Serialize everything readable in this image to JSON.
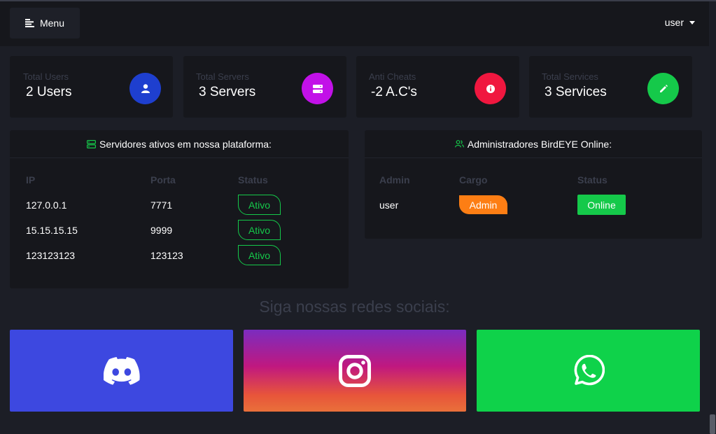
{
  "navbar": {
    "menu_label": "Menu",
    "user_label": "user"
  },
  "stats": [
    {
      "label": "Total Users",
      "value": "2 Users",
      "icon": "user-icon",
      "color": "#1e3fcf"
    },
    {
      "label": "Total Servers",
      "value": "3 Servers",
      "icon": "server-icon",
      "color": "#c211e8"
    },
    {
      "label": "Anti Cheats",
      "value": "-2 A.C's",
      "icon": "info-icon",
      "color": "#f0173f"
    },
    {
      "label": "Total Services",
      "value": "3 Services",
      "icon": "pencil-icon",
      "color": "#15c94a"
    }
  ],
  "servers_panel": {
    "title": "Servidores ativos em nossa plataforma:",
    "columns": [
      "IP",
      "Porta",
      "Status"
    ],
    "rows": [
      {
        "ip": "127.0.0.1",
        "port": "7771",
        "status": "Ativo"
      },
      {
        "ip": "15.15.15.15",
        "port": "9999",
        "status": "Ativo"
      },
      {
        "ip": "123123123",
        "port": "123123",
        "status": "Ativo"
      }
    ]
  },
  "admins_panel": {
    "title": "Administradores BirdEYE Online:",
    "columns": [
      "Admin",
      "Cargo",
      "Status"
    ],
    "rows": [
      {
        "admin": "user",
        "cargo": "Admin",
        "status": "Online"
      }
    ]
  },
  "social": {
    "title": "Siga nossas redes sociais:",
    "cards": [
      {
        "name": "discord",
        "icon": "discord-icon",
        "color": "#3d48e0"
      },
      {
        "name": "instagram",
        "icon": "instagram-icon",
        "color": "#c0187f"
      },
      {
        "name": "whatsapp",
        "icon": "whatsapp-icon",
        "color": "#0fd24a"
      }
    ]
  },
  "colors": {
    "background": "#1c1e26",
    "panel": "#16171c",
    "muted_text": "#3b3f4d",
    "accent_green": "#15c94a",
    "accent_orange": "#fd7e14"
  }
}
